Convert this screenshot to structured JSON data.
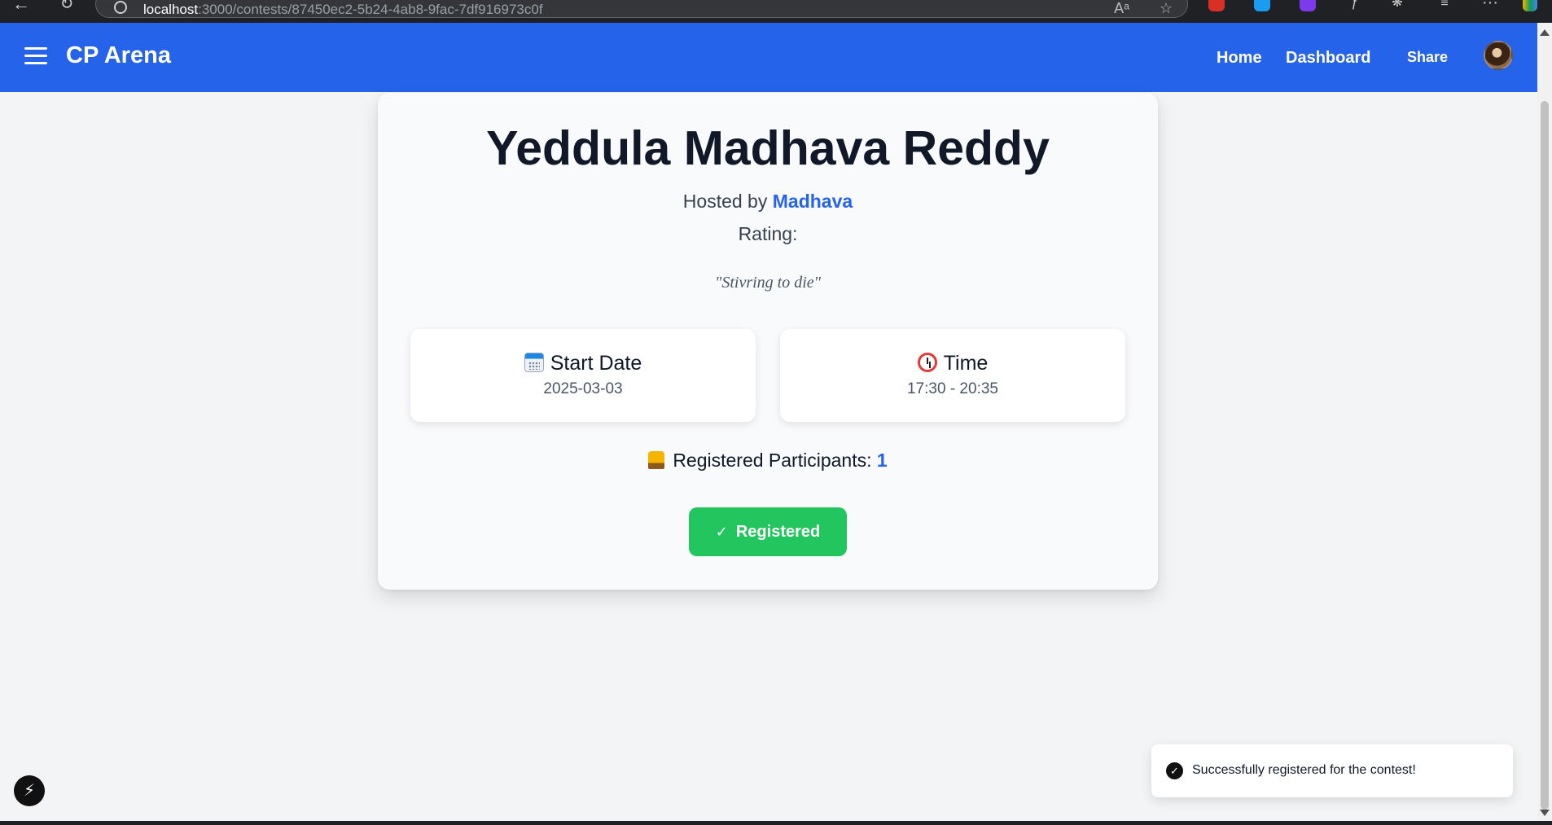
{
  "browser": {
    "url_host": "localhost",
    "url_path": ":3000/contests/87450ec2-5b24-4ab8-9fac-7df916973c0f",
    "read_aloud": "Aᵃ"
  },
  "header": {
    "brand": "CP Arena",
    "nav": {
      "home": "Home",
      "dashboard": "Dashboard",
      "share": "Share"
    },
    "accent_color": "#2563eb"
  },
  "contest": {
    "title": "Yeddula Madhava Reddy",
    "hosted_by_prefix": "Hosted by",
    "host_name": "Madhava",
    "rating_label": "Rating:",
    "quote": "\"Stivring to die\"",
    "start_date": {
      "icon": "calendar-icon",
      "label": "Start Date",
      "value": "2025-03-03"
    },
    "time": {
      "icon": "alarm-clock-icon",
      "label": "Time",
      "value": "17:30 - 20:35"
    },
    "participants_label": "Registered Participants:",
    "participants_count": "1",
    "register_button": "Registered",
    "register_button_color": "#22c55e"
  },
  "toast": {
    "message": "Successfully registered for the contest!"
  }
}
